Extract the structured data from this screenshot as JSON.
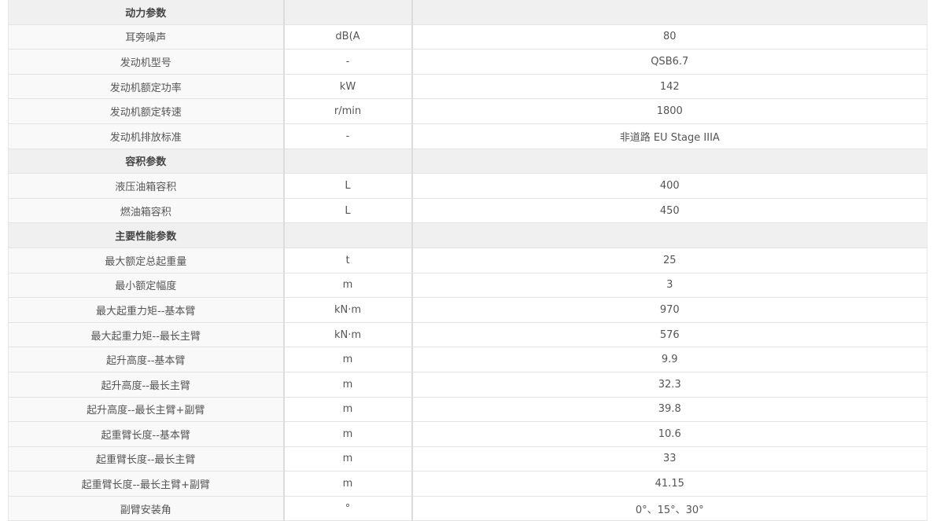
{
  "table": {
    "rows": [
      {
        "type": "section",
        "name": "动力参数",
        "unit": "",
        "value": ""
      },
      {
        "type": "item",
        "name": "耳旁噪声",
        "unit": "dB(A",
        "value": "80"
      },
      {
        "type": "item",
        "name": "发动机型号",
        "unit": "-",
        "value": "QSB6.7"
      },
      {
        "type": "item",
        "name": "发动机额定功率",
        "unit": "kW",
        "value": "142"
      },
      {
        "type": "item",
        "name": "发动机额定转速",
        "unit": "r/min",
        "value": "1800"
      },
      {
        "type": "item",
        "name": "发动机排放标准",
        "unit": "-",
        "value": "非道路 EU Stage IIIA"
      },
      {
        "type": "section",
        "name": "容积参数",
        "unit": "",
        "value": ""
      },
      {
        "type": "item",
        "name": "液压油箱容积",
        "unit": "L",
        "value": "400"
      },
      {
        "type": "item",
        "name": "燃油箱容积",
        "unit": "L",
        "value": "450"
      },
      {
        "type": "section",
        "name": "主要性能参数",
        "unit": "",
        "value": ""
      },
      {
        "type": "item",
        "name": "最大额定总起重量",
        "unit": "t",
        "value": "25"
      },
      {
        "type": "item",
        "name": "最小额定幅度",
        "unit": "m",
        "value": "3"
      },
      {
        "type": "item",
        "name": "最大起重力矩--基本臂",
        "unit": "kN·m",
        "value": "970"
      },
      {
        "type": "item",
        "name": "最大起重力矩--最长主臂",
        "unit": "kN·m",
        "value": "576"
      },
      {
        "type": "item",
        "name": "起升高度--基本臂",
        "unit": "m",
        "value": "9.9"
      },
      {
        "type": "item",
        "name": "起升高度--最长主臂",
        "unit": "m",
        "value": "32.3"
      },
      {
        "type": "item",
        "name": "起升高度--最长主臂+副臂",
        "unit": "m",
        "value": "39.8"
      },
      {
        "type": "item",
        "name": "起重臂长度--基本臂",
        "unit": "m",
        "value": "10.6"
      },
      {
        "type": "item",
        "name": "起重臂长度--最长主臂",
        "unit": "m",
        "value": "33"
      },
      {
        "type": "item",
        "name": "起重臂长度--最长主臂+副臂",
        "unit": "m",
        "value": "41.15"
      },
      {
        "type": "item",
        "name": "副臂安装角",
        "unit": "°",
        "value": "0°、15°、30°"
      }
    ]
  }
}
